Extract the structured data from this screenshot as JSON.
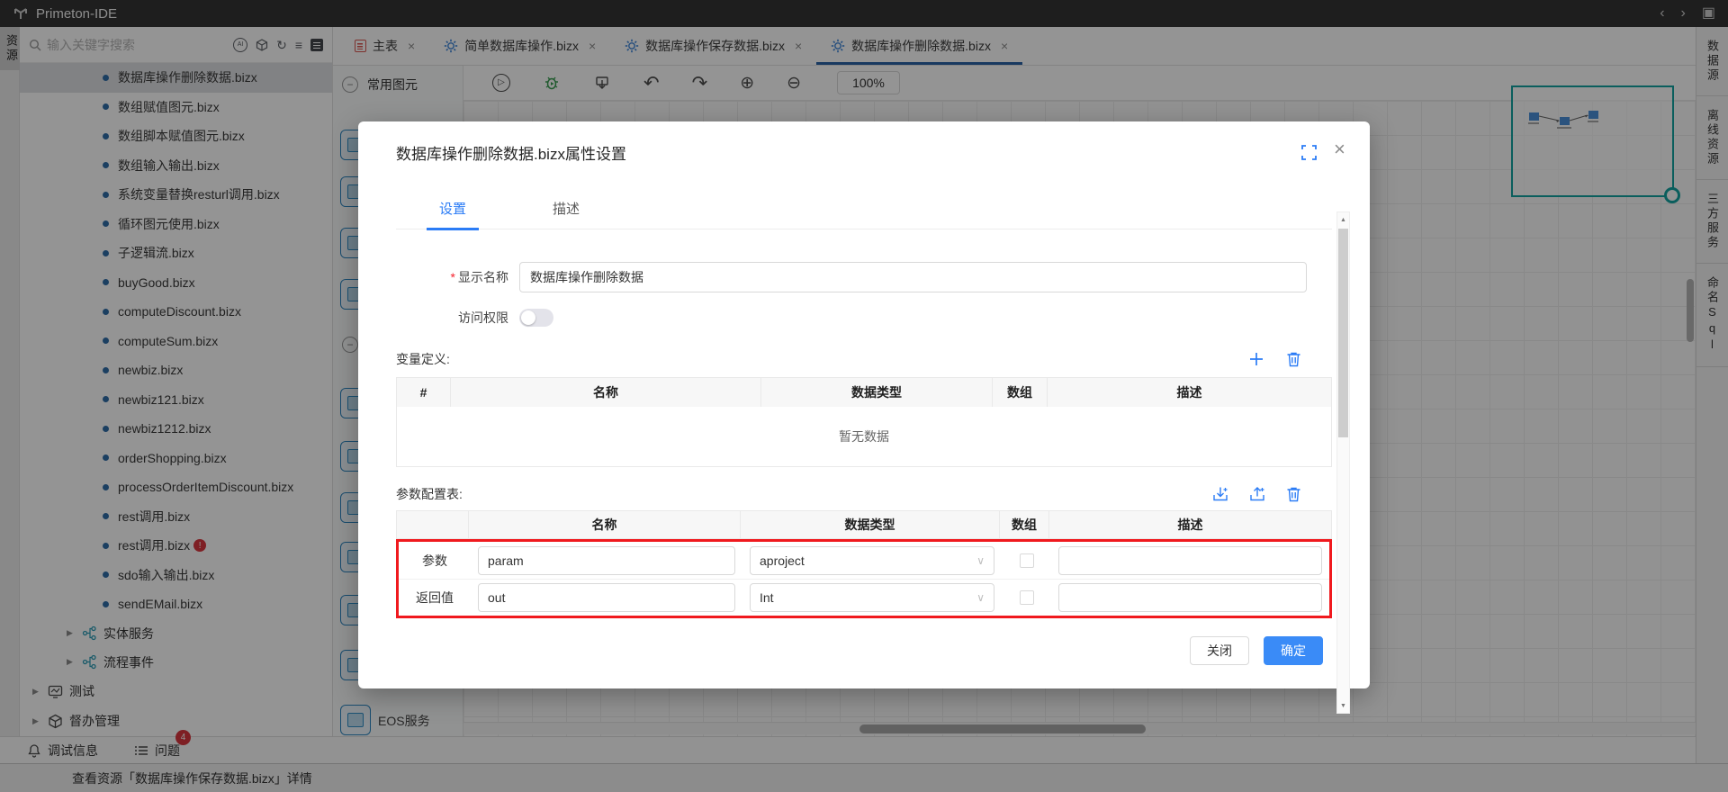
{
  "titlebar": {
    "app_title": "Primeton-IDE"
  },
  "icons": {
    "close": "×",
    "chevron": "∨",
    "run": "▷",
    "undo": "↶",
    "redo": "↷",
    "zoom_in": "⊕",
    "zoom_out": "⊖",
    "refresh": "↻",
    "menu": "≡",
    "ai": "AI",
    "back": "‹",
    "forward": "›",
    "save": "▣",
    "up": "▲",
    "down": "▼",
    "expand": "▶",
    "minus": "−",
    "error": "!",
    "asterisk": "*"
  },
  "left_rail": {
    "tab": "资源"
  },
  "sidebar": {
    "search_placeholder": "输入关键字搜索",
    "files": [
      {
        "label": "数据库操作删除数据.bizx",
        "selected": true
      },
      {
        "label": "数组赋值图元.bizx"
      },
      {
        "label": "数组脚本赋值图元.bizx"
      },
      {
        "label": "数组输入输出.bizx"
      },
      {
        "label": "系统变量替换resturl调用.bizx"
      },
      {
        "label": "循环图元使用.bizx"
      },
      {
        "label": "子逻辑流.bizx"
      },
      {
        "label": "buyGood.bizx"
      },
      {
        "label": "computeDiscount.bizx"
      },
      {
        "label": "computeSum.bizx"
      },
      {
        "label": "newbiz.bizx"
      },
      {
        "label": "newbiz121.bizx"
      },
      {
        "label": "newbiz1212.bizx"
      },
      {
        "label": "orderShopping.bizx"
      },
      {
        "label": "processOrderItemDiscount.bizx"
      },
      {
        "label": "rest调用.bizx"
      },
      {
        "label": "rest调用.bizx",
        "error": true
      },
      {
        "label": "sdo输入输出.bizx"
      },
      {
        "label": "sendEMail.bizx"
      }
    ],
    "tree_mid": [
      {
        "label": "实体服务"
      },
      {
        "label": "流程事件"
      }
    ],
    "tree_bottom": [
      {
        "label": "测试"
      },
      {
        "label": "督办管理"
      }
    ],
    "bottom_tabs": [
      {
        "label": "调试信息"
      },
      {
        "label": "问题",
        "badge": "4"
      }
    ]
  },
  "palette": {
    "header": "常用图元",
    "eos_label": "EOS服务"
  },
  "editor_tabs": [
    {
      "label": "主表"
    },
    {
      "label": "简单数据库操作.bizx"
    },
    {
      "label": "数据库操作保存数据.bizx"
    },
    {
      "label": "数据库操作删除数据.bizx",
      "active": true
    }
  ],
  "toolbar": {
    "zoom_level": "100%"
  },
  "right_rail": {
    "tabs": [
      "数据源",
      "离线资源",
      "三方服务",
      "命名Sql"
    ]
  },
  "statusbar": {
    "text": "查看资源「数据库操作保存数据.bizx」详情"
  },
  "modal": {
    "title": "数据库操作删除数据.bizx属性设置",
    "tabs": [
      {
        "label": "设置",
        "active": true
      },
      {
        "label": "描述"
      }
    ],
    "display_name_label": "显示名称",
    "display_name_value": "数据库操作删除数据",
    "access_label": "访问权限",
    "var_section_label": "变量定义:",
    "var_table_headers": [
      "#",
      "名称",
      "数据类型",
      "数组",
      "描述"
    ],
    "var_table_empty": "暂无数据",
    "param_section_label": "参数配置表:",
    "param_table_headers": [
      "",
      "名称",
      "数据类型",
      "数组",
      "描述"
    ],
    "param_rows": [
      {
        "row_label": "参数",
        "name": "param",
        "type": "aproject"
      },
      {
        "row_label": "返回值",
        "name": "out",
        "type": "Int"
      }
    ],
    "close_label": "关闭",
    "ok_label": "确定"
  },
  "colors": {
    "accent": "#2b7cf6",
    "danger": "#f5222d",
    "highlight_border": "#f0191e",
    "active_tab_underline": "#2a62a5",
    "minimap": "#12a3a0"
  }
}
